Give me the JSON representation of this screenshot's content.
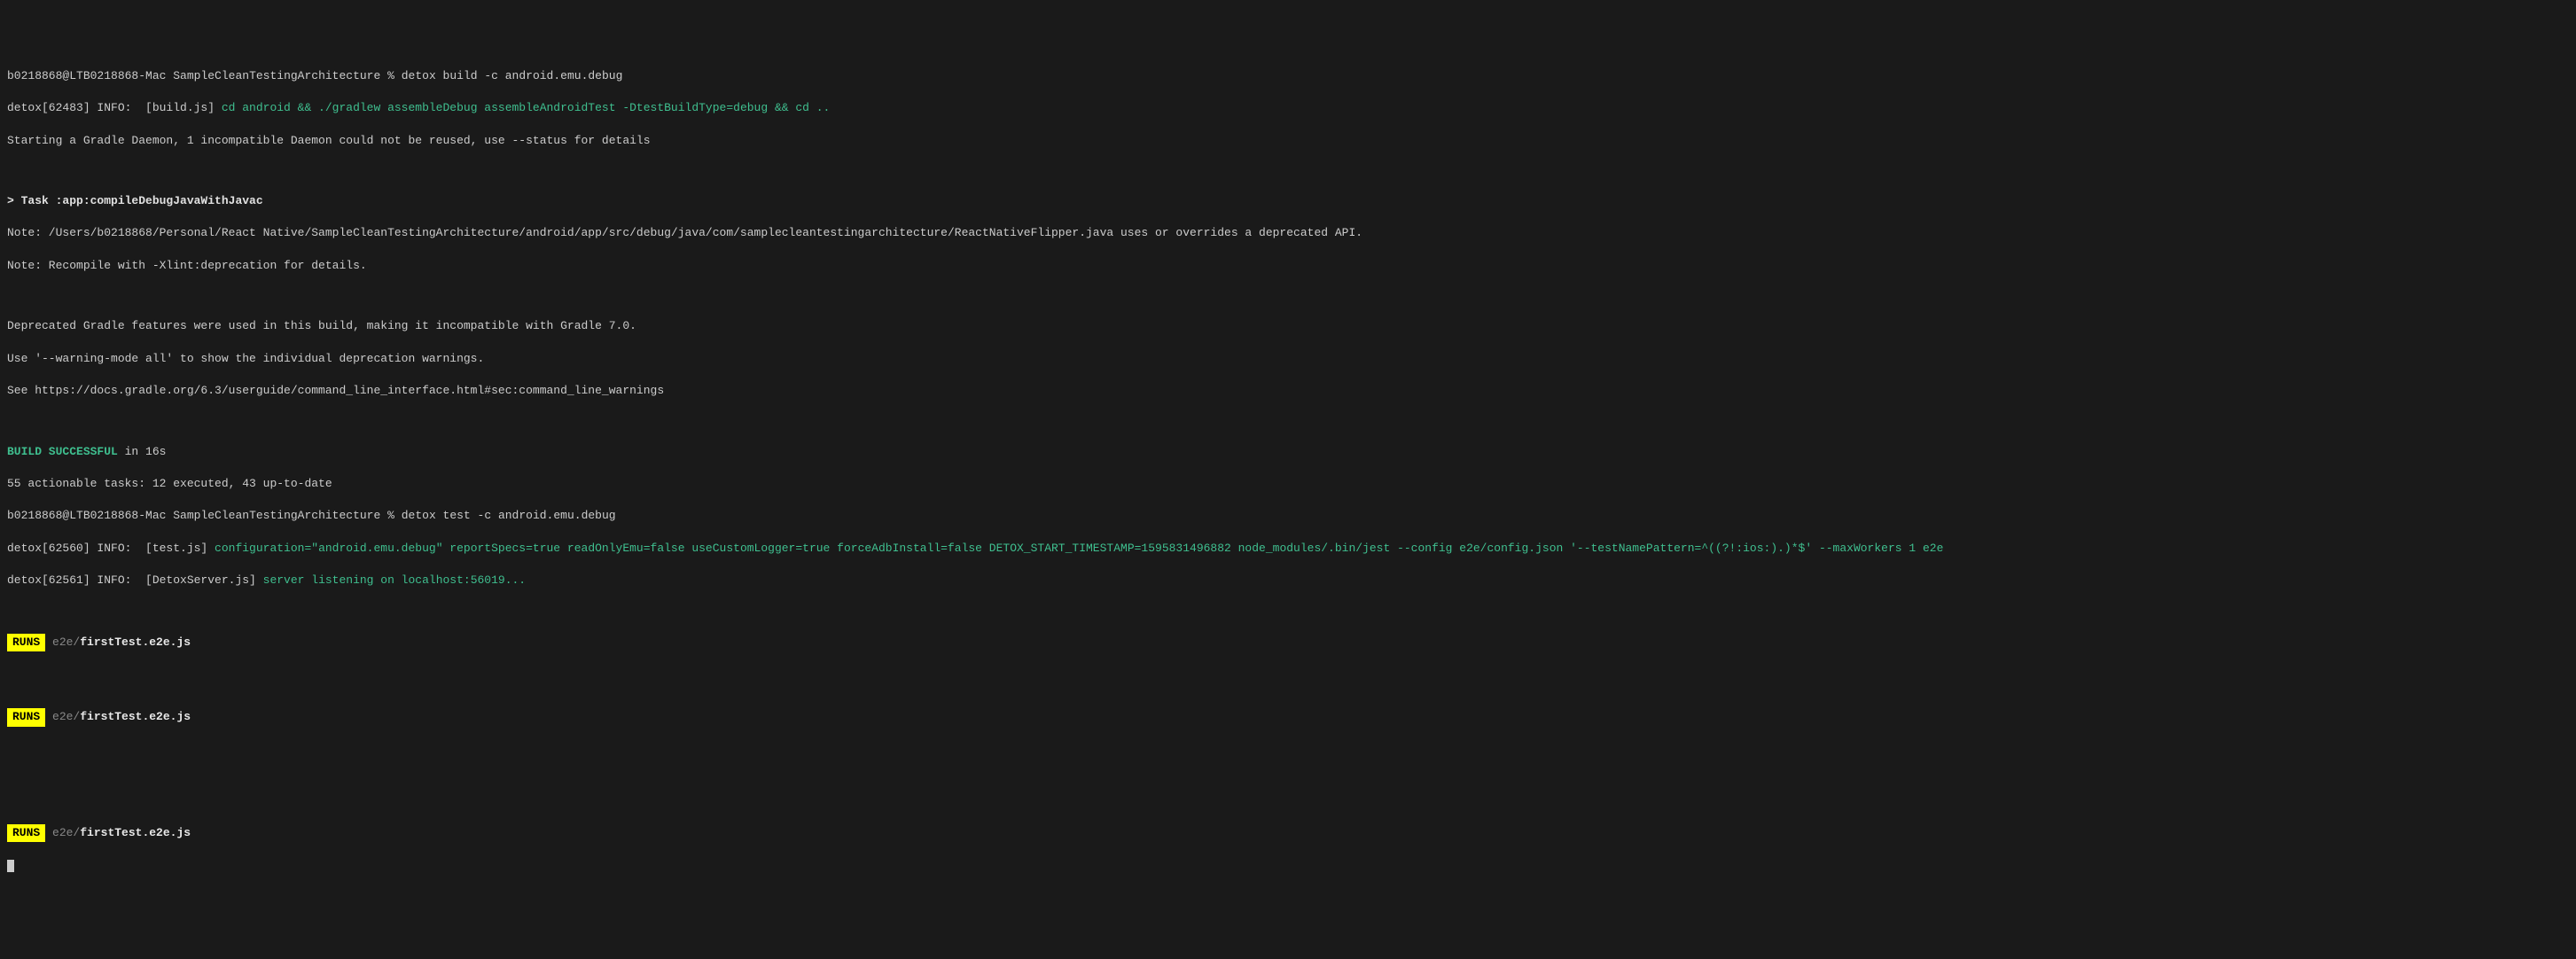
{
  "prompt1": {
    "user_host": "b0218868@LTB0218868-Mac",
    "dir": "SampleCleanTestingArchitecture",
    "symbol": "%",
    "cmd": "detox build -c android.emu.debug"
  },
  "line2": {
    "prefix": "detox[62483] INFO:  [build.js] ",
    "cmd": "cd android && ./gradlew assembleDebug assembleAndroidTest -DtestBuildType=debug && cd .."
  },
  "line3": "Starting a Gradle Daemon, 1 incompatible Daemon could not be reused, use --status for details",
  "task_line": "> Task :app:compileDebugJavaWithJavac",
  "note1": "Note: /Users/b0218868/Personal/React Native/SampleCleanTestingArchitecture/android/app/src/debug/java/com/samplecleantestingarchitecture/ReactNativeFlipper.java uses or overrides a deprecated API.",
  "note2": "Note: Recompile with -Xlint:deprecation for details.",
  "dep1": "Deprecated Gradle features were used in this build, making it incompatible with Gradle 7.0.",
  "dep2": "Use '--warning-mode all' to show the individual deprecation warnings.",
  "dep3": "See https://docs.gradle.org/6.3/userguide/command_line_interface.html#sec:command_line_warnings",
  "build_success": "BUILD SUCCESSFUL",
  "build_time": " in 16s",
  "tasks_line": "55 actionable tasks: 12 executed, 43 up-to-date",
  "prompt2": {
    "user_host": "b0218868@LTB0218868-Mac",
    "dir": "SampleCleanTestingArchitecture",
    "symbol": "%",
    "cmd": "detox test -c android.emu.debug"
  },
  "testjs": {
    "prefix": "detox[62560] INFO:  [test.js] ",
    "cfg": "configuration=\"android.emu.debug\" reportSpecs=true readOnlyEmu=false useCustomLogger=true forceAdbInstall=false DETOX_START_TIMESTAMP=1595831496882 node_modules/.bin/jest --config e2e/config.json '--testNamePattern=^((?!:ios:).)*$' --maxWorkers 1 e2e"
  },
  "server": {
    "prefix": "detox[62561] INFO:  [DetoxServer.js] ",
    "msg": "server listening on localhost:56019..."
  },
  "runs": {
    "badge": "RUNS",
    "path_dim": " e2e/",
    "file": "firstTest.e2e.js"
  }
}
